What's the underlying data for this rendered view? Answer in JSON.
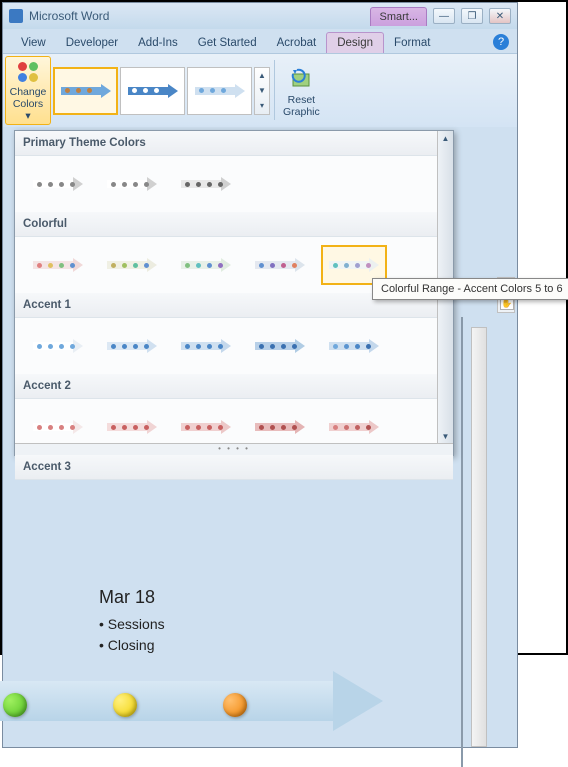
{
  "titlebar": {
    "app_name": "Microsoft Word",
    "context_tab": "Smart..."
  },
  "tabs": [
    "View",
    "Developer",
    "Add-Ins",
    "Get Started",
    "Acrobat",
    "Design",
    "Format"
  ],
  "active_tab_index": 5,
  "ribbon": {
    "change_colors_label_1": "Change",
    "change_colors_label_2": "Colors ▾",
    "reset_label_1": "Reset",
    "reset_label_2": "Graphic"
  },
  "dropdown": {
    "sections": [
      {
        "heading": "Primary Theme Colors",
        "rows": 1,
        "cols": 3
      },
      {
        "heading": "Colorful",
        "rows": 1,
        "cols": 5
      },
      {
        "heading": "Accent 1",
        "rows": 1,
        "cols": 5
      },
      {
        "heading": "Accent 2",
        "rows": 1,
        "cols": 5
      },
      {
        "heading": "Accent 3",
        "rows": 0,
        "cols": 0
      }
    ]
  },
  "tooltip_text": "Colorful Range - Accent Colors 5 to 6",
  "doc": {
    "date": "Mar 18",
    "bullets": [
      "Sessions",
      "Closing"
    ],
    "dots": [
      "#50c020",
      "#f0d000",
      "#f08000"
    ]
  }
}
